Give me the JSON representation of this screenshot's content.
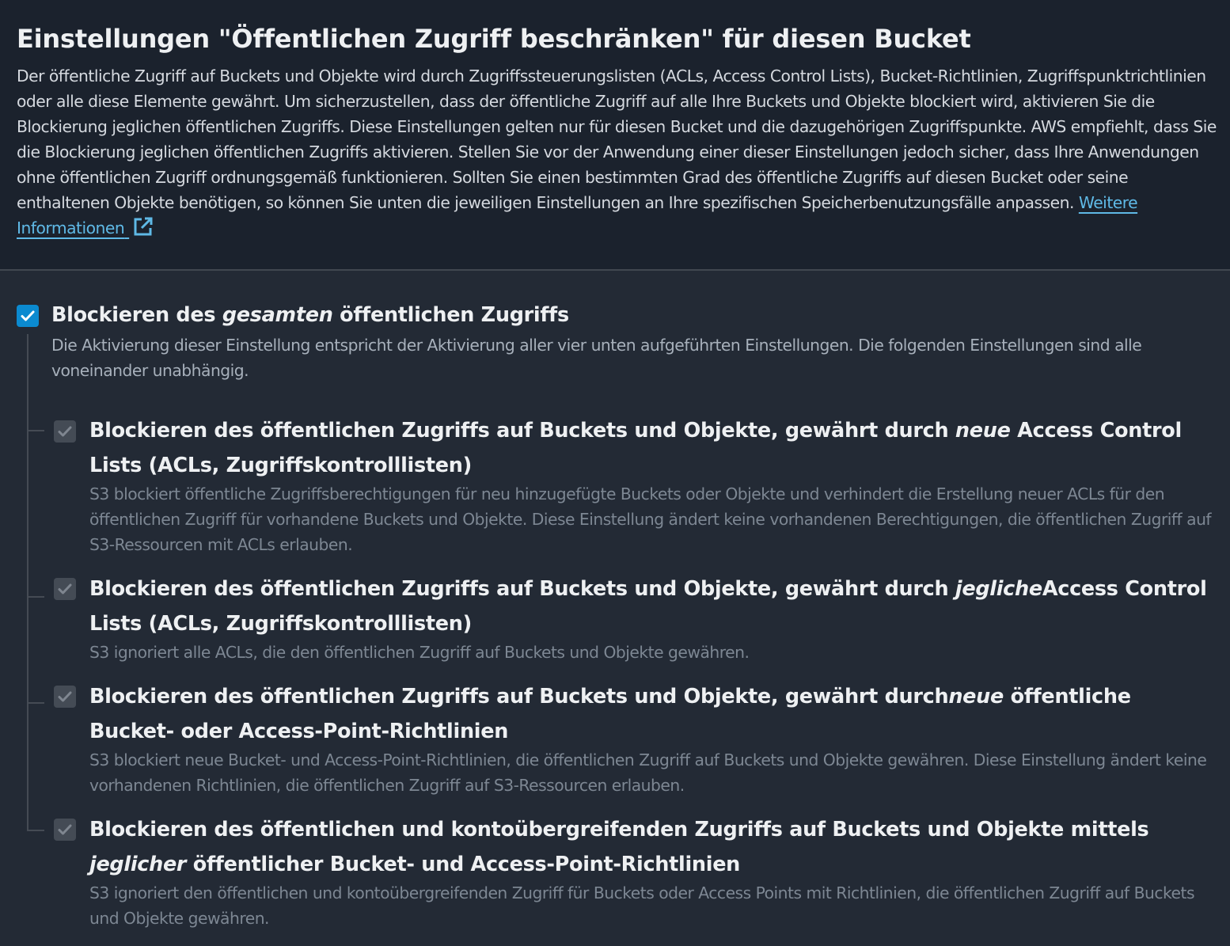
{
  "header": {
    "title": "Einstellungen \"Öffentlichen Zugriff beschränken\" für diesen Bucket",
    "description": "Der öffentliche Zugriff auf Buckets und Objekte wird durch Zugriffssteuerungslisten (ACLs, Access Control Lists), Bucket-Richtlinien, Zugriffspunktrichtlinien oder alle diese Elemente gewährt. Um sicherzustellen, dass der öffentliche Zugriff auf alle Ihre Buckets und Objekte blockiert wird, aktivieren Sie die Blockierung jeglichen öffentlichen Zugriffs. Diese Einstellungen gelten nur für diesen Bucket und die dazugehörigen Zugriffspunkte. AWS empfiehlt, dass Sie die Blockierung jeglichen öffentlichen Zugriffs aktivieren. Stellen Sie vor der Anwendung einer dieser Einstellungen jedoch sicher, dass Ihre Anwendungen ohne öffentlichen Zugriff ordnungsgemäß funktionieren. Sollten Sie einen bestimmten Grad des öffentliche Zugriffs auf diesen Bucket oder seine enthaltenen Objekte benötigen, so können Sie unten die jeweiligen Einstellungen an Ihre spezifischen Speicherbenutzungsfälle anpassen. ",
    "learn_more_link": "Weitere Informationen",
    "learn_more_icon": "external-link-icon"
  },
  "block_all": {
    "checked": true,
    "label_before": "Blockieren des ",
    "label_em": "gesamten",
    "label_after": " öffentlichen Zugriffs",
    "description": "Die Aktivierung dieser Einstellung entspricht der Aktivierung aller vier unten aufgeführten Einstellungen. Die folgenden Einstellungen sind alle voneinander unabhängig."
  },
  "options": [
    {
      "checked": true,
      "label_before": "Blockieren des öffentlichen Zugriffs auf Buckets und Objekte, gewährt durch ",
      "label_em": "neue",
      "label_after": " Access Control Lists (ACLs, Zugriffskontrolllisten)",
      "description": "S3 blockiert öffentliche Zugriffsberechtigungen für neu hinzugefügte Buckets oder Objekte und verhindert die Erstellung neuer ACLs für den öffentlichen Zugriff für vorhandene Buckets und Objekte. Diese Einstellung ändert keine vorhandenen Berechtigungen, die öffentlichen Zugriff auf S3-Ressourcen mit ACLs erlauben."
    },
    {
      "checked": true,
      "label_before": "Blockieren des öffentlichen Zugriffs auf Buckets und Objekte, gewährt durch ",
      "label_em": "jegliche",
      "label_after": "Access Control Lists (ACLs, Zugriffskontrolllisten)",
      "description": "S3 ignoriert alle ACLs, die den öffentlichen Zugriff auf Buckets und Objekte gewähren."
    },
    {
      "checked": true,
      "label_before": "Blockieren des öffentlichen Zugriffs auf Buckets und Objekte, gewährt durch",
      "label_em": "neue",
      "label_after": " öffentliche Bucket- oder Access-Point-Richtlinien",
      "description": "S3 blockiert neue Bucket- und Access-Point-Richtlinien, die öffentlichen Zugriff auf Buckets und Objekte gewähren. Diese Einstellung ändert keine vorhandenen Richtlinien, die öffentlichen Zugriff auf S3-Ressourcen erlauben."
    },
    {
      "checked": true,
      "label_before": "Blockieren des öffentlichen und kontoübergreifenden Zugriffs auf Buckets und Objekte mittels ",
      "label_em": "jeglicher",
      "label_after": " öffentlicher Bucket- und Access-Point-Richtlinien",
      "description": "S3 ignoriert den öffentlichen und kontoübergreifenden Zugriff für Buckets oder Access Points mit Richtlinien, die öffentlichen Zugriff auf Buckets und Objekte gewähren."
    }
  ],
  "colors": {
    "background": "#232a35",
    "header_background": "#1b222d",
    "checkbox_checked": "#0b8ad0",
    "checkbox_disabled": "#444b55",
    "link": "#5fb9e6"
  }
}
